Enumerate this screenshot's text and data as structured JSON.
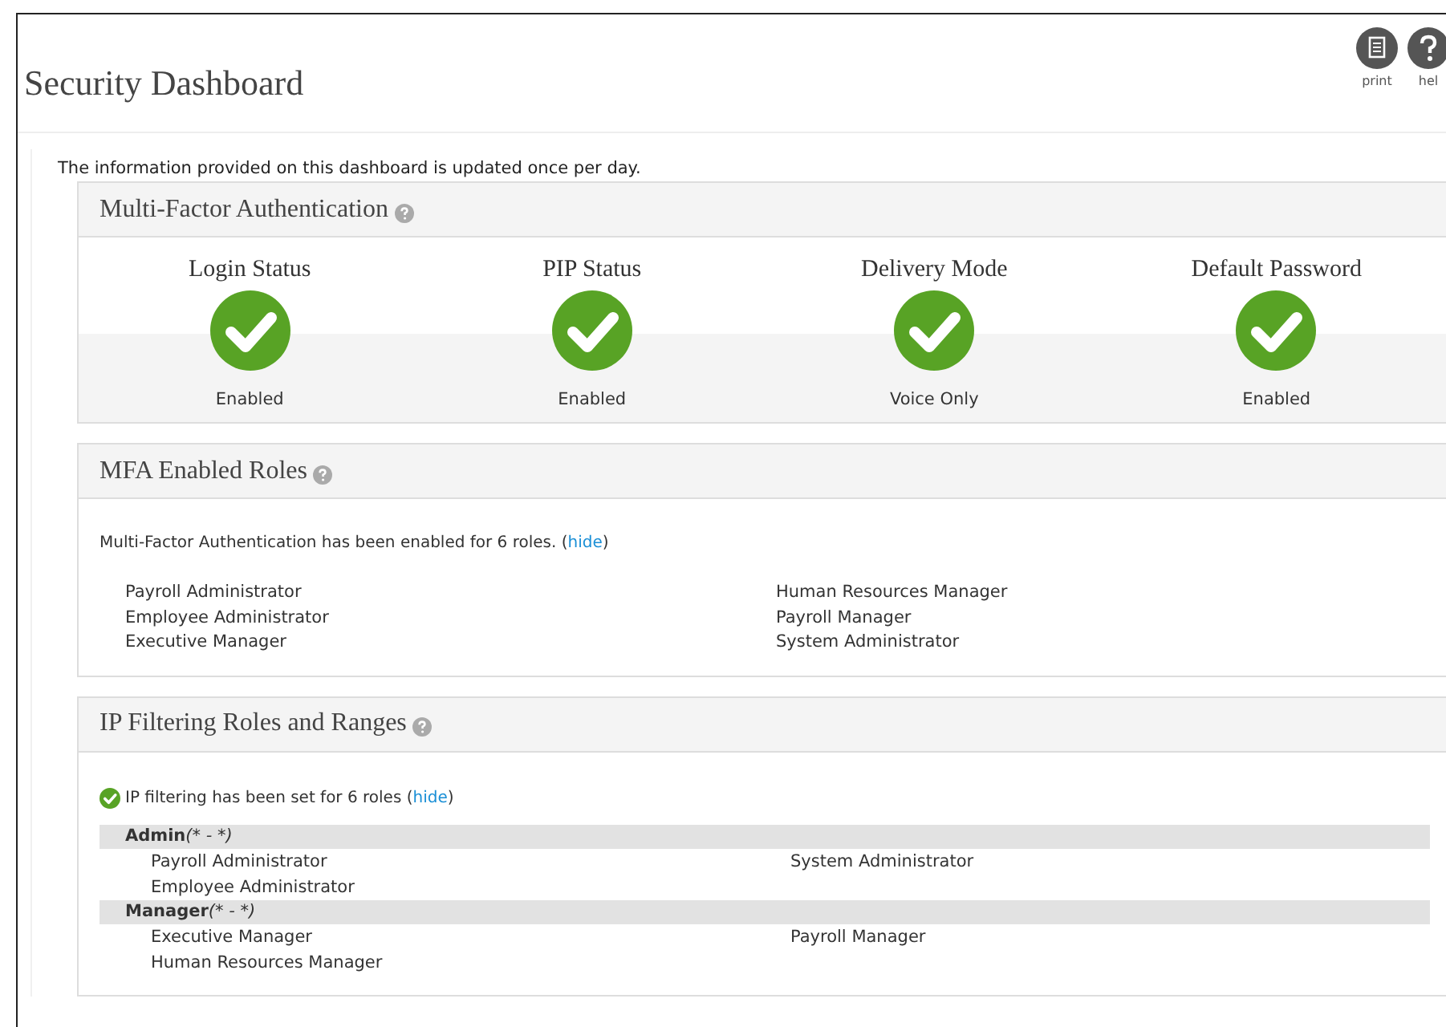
{
  "page": {
    "title": "Security Dashboard",
    "actions": [
      {
        "kind": "print",
        "label": "print"
      },
      {
        "kind": "help",
        "label": "hel"
      }
    ]
  },
  "note": "The information provided on this dashboard is updated once per day.",
  "mfa": {
    "title": "Multi-Factor Authentication",
    "statuses": [
      {
        "label": "Login Status",
        "ok": true,
        "value": "Enabled"
      },
      {
        "label": "PIP Status",
        "ok": true,
        "value": "Enabled"
      },
      {
        "label": "Delivery Mode",
        "ok": true,
        "value": "Voice Only"
      },
      {
        "label": "Default Password",
        "ok": true,
        "value": "Enabled"
      }
    ]
  },
  "mfa_roles": {
    "title": "MFA Enabled Roles",
    "summary": "Multi-Factor Authentication has been enabled for 6 roles. (",
    "link": "hide",
    "summary_end": ")",
    "roles": [
      "Payroll Administrator",
      "Employee Administrator",
      "Executive Manager",
      "Human Resources Manager",
      "Payroll Manager",
      "System Administrator"
    ]
  },
  "ip": {
    "title": "IP Filtering Roles and Ranges",
    "summary": "IP filtering has been set for 6 roles (",
    "link": "hide",
    "summary_end": ")",
    "groups": [
      {
        "name": "Admin",
        "range": "(* - *)",
        "roles": [
          "Payroll Administrator",
          "System Administrator",
          "Employee Administrator"
        ]
      },
      {
        "name": "Manager",
        "range": "(* - *)",
        "roles": [
          "Executive Manager",
          "Payroll Manager",
          "Human Resources Manager"
        ]
      }
    ]
  }
}
